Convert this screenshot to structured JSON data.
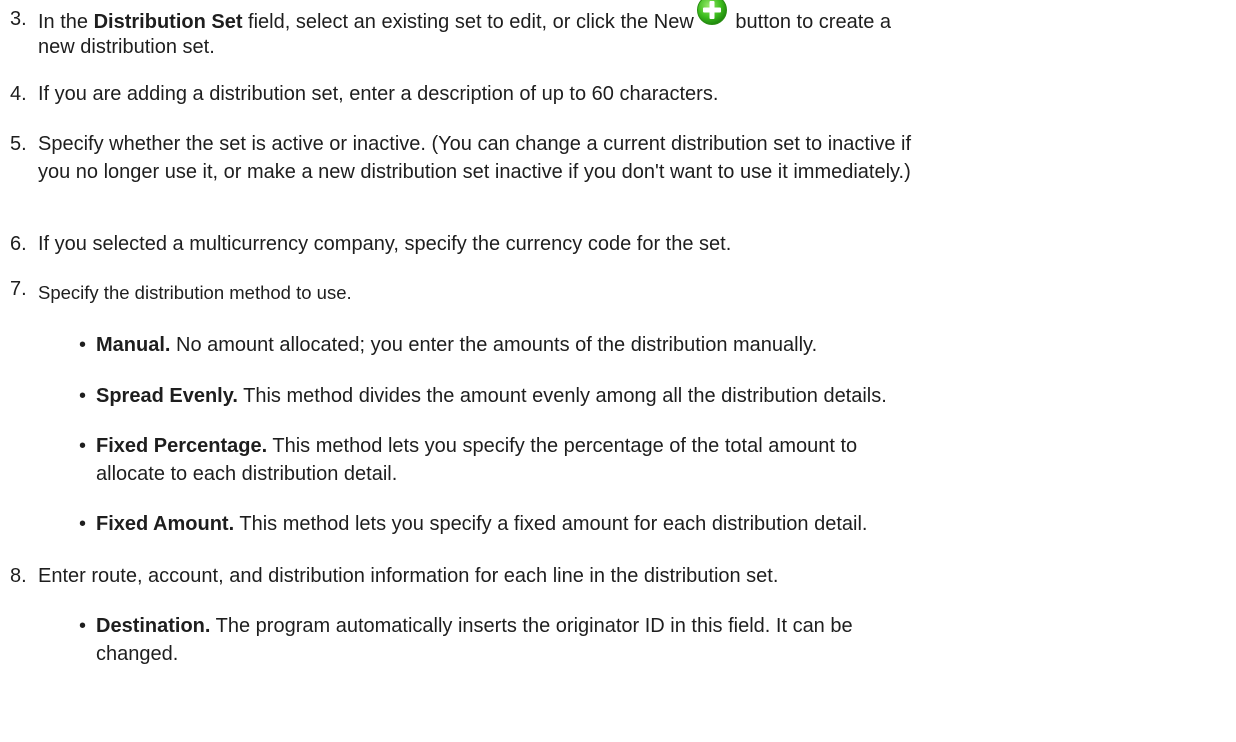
{
  "steps": {
    "s3": {
      "num": "3.",
      "pre": "In the ",
      "bold": "Distribution Set",
      "mid": " field, select an existing set to edit, or click the New",
      "post": " button to create a",
      "line2": "new distribution set."
    },
    "s4": {
      "num": "4.",
      "text": "If you are adding a distribution set, enter a description of up to 60 characters."
    },
    "s5": {
      "num": "5.",
      "line1": "Specify whether the set is active or inactive. (You can change a current distribution set to inactive if",
      "line2": "you no longer use it, or make a new distribution set inactive if you don't want to use it immediately.)"
    },
    "s6": {
      "num": "6.",
      "text": "If you selected a multicurrency company, specify the currency code for the set."
    },
    "s7": {
      "num": "7.",
      "text": "Specify the distribution method to use.",
      "bullets": [
        {
          "bold": "Manual.",
          "line1": " No amount allocated; you enter the amounts of the distribution manually."
        },
        {
          "bold": "Spread Evenly.",
          "line1": " This method divides the amount evenly among all the distribution details."
        },
        {
          "bold": "Fixed Percentage.",
          "line1": " This method lets you specify the percentage of the total amount to",
          "line2": "allocate to each distribution detail."
        },
        {
          "bold": "Fixed Amount.",
          "line1": " This method lets you specify a fixed amount for each distribution detail."
        }
      ]
    },
    "s8": {
      "num": "8.",
      "text": "Enter route, account, and distribution information for each line in the distribution set.",
      "bullets": [
        {
          "bold": "Destination.",
          "line1": " The program automatically inserts the originator ID in this field. It can be",
          "line2": "changed."
        }
      ]
    }
  },
  "icons": {
    "new_button": "green-plus-circle-icon"
  },
  "colors": {
    "text": "#1e1e1e",
    "icon_green": "#3fbf1f"
  }
}
